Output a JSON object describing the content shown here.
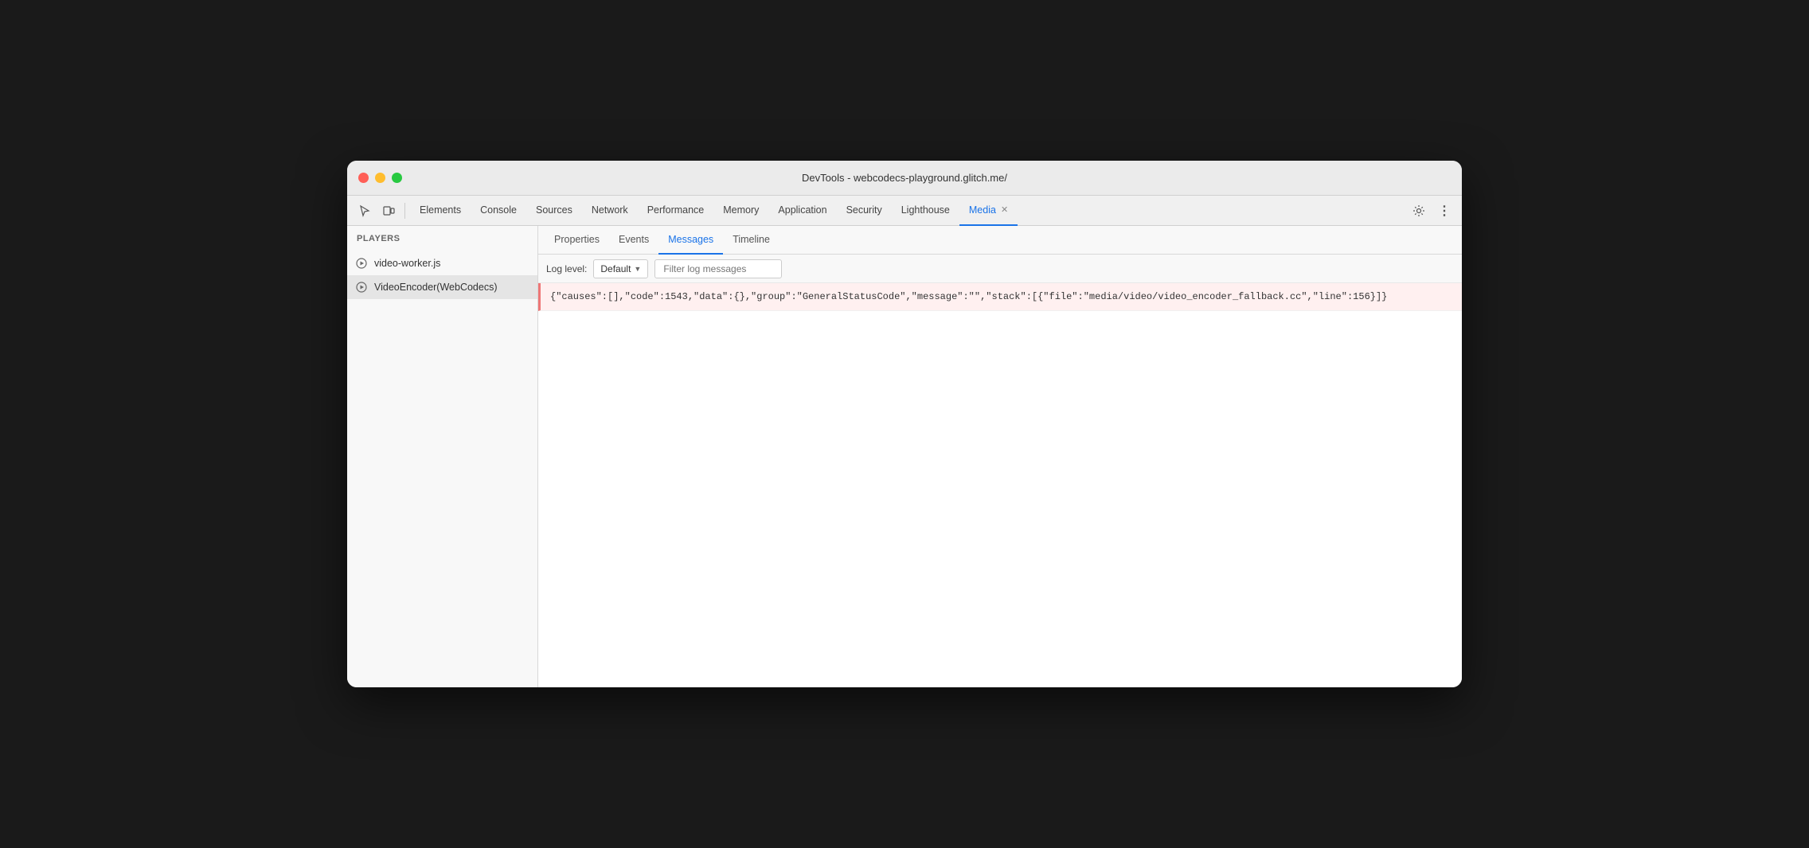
{
  "window": {
    "title": "DevTools - webcodecs-playground.glitch.me/"
  },
  "traffic_lights": {
    "close_label": "close",
    "min_label": "minimize",
    "max_label": "maximize"
  },
  "toolbar": {
    "tabs": [
      {
        "id": "elements",
        "label": "Elements",
        "active": false
      },
      {
        "id": "console",
        "label": "Console",
        "active": false
      },
      {
        "id": "sources",
        "label": "Sources",
        "active": false
      },
      {
        "id": "network",
        "label": "Network",
        "active": false
      },
      {
        "id": "performance",
        "label": "Performance",
        "active": false
      },
      {
        "id": "memory",
        "label": "Memory",
        "active": false
      },
      {
        "id": "application",
        "label": "Application",
        "active": false
      },
      {
        "id": "security",
        "label": "Security",
        "active": false
      },
      {
        "id": "lighthouse",
        "label": "Lighthouse",
        "active": false
      },
      {
        "id": "media",
        "label": "Media",
        "active": true,
        "closeable": true
      }
    ]
  },
  "sidebar": {
    "header": "Players",
    "players": [
      {
        "id": "video-worker",
        "label": "video-worker.js",
        "active": false
      },
      {
        "id": "video-encoder",
        "label": "VideoEncoder(WebCodecs)",
        "active": true
      }
    ]
  },
  "panel": {
    "tabs": [
      {
        "id": "properties",
        "label": "Properties",
        "active": false
      },
      {
        "id": "events",
        "label": "Events",
        "active": false
      },
      {
        "id": "messages",
        "label": "Messages",
        "active": true
      },
      {
        "id": "timeline",
        "label": "Timeline",
        "active": false
      }
    ],
    "log_controls": {
      "label": "Log level:",
      "level": "Default",
      "filter_placeholder": "Filter log messages"
    },
    "log_entries": [
      {
        "id": "entry-1",
        "type": "error",
        "text": "{\"causes\":[],\"code\":1543,\"data\":{},\"group\":\"GeneralStatusCode\",\"message\":\"\",\"stack\":[{\"file\":\"media/video/video_encoder_fallback.cc\",\"line\":156}]}"
      }
    ]
  },
  "icons": {
    "cursor": "⬚",
    "device": "☰",
    "settings": "⚙",
    "more": "⋮",
    "play_circle": "▶"
  }
}
